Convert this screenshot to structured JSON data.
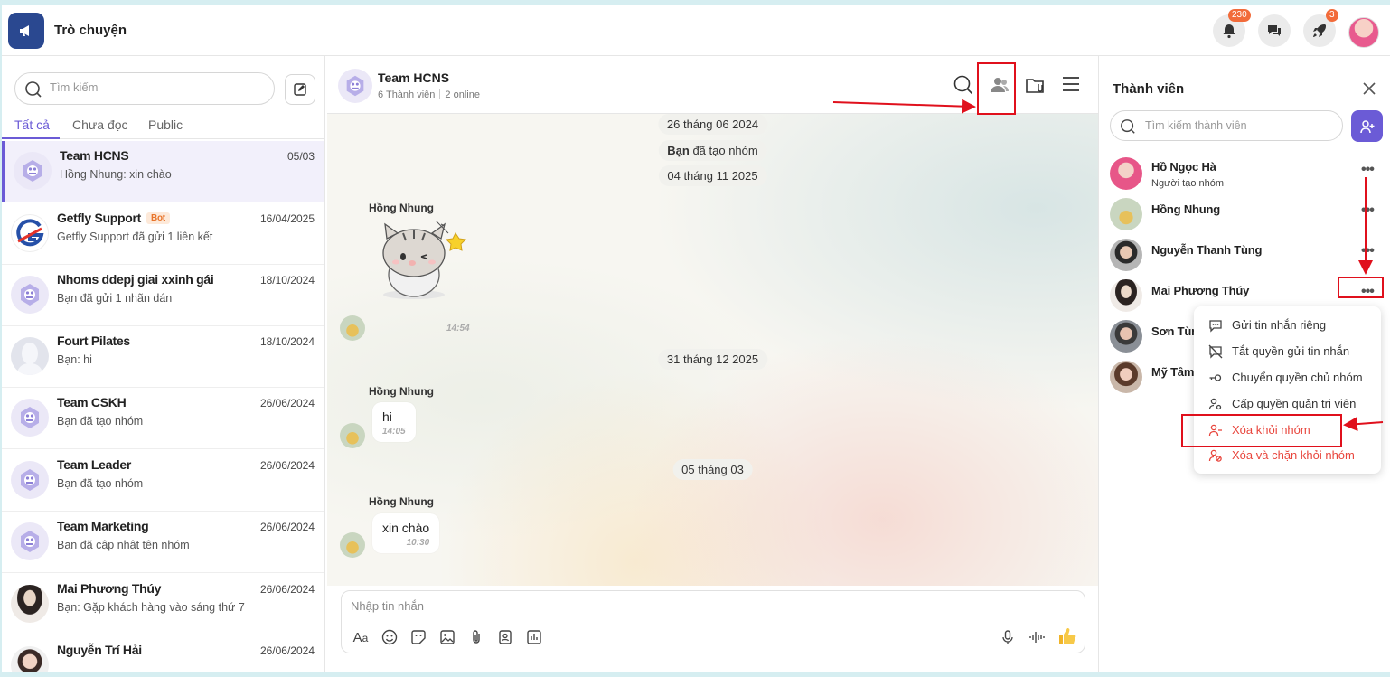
{
  "header": {
    "title": "Trò chuyện",
    "notif_count": "230",
    "rocket_count": "3"
  },
  "sidebar": {
    "search_placeholder": "Tìm kiếm",
    "tabs": [
      "Tất cả",
      "Chưa đọc",
      "Public"
    ],
    "conversations": [
      {
        "name": "Team HCNS",
        "preview": "Hồng Nhung: xin chào",
        "date": "05/03"
      },
      {
        "name": "Getfly Support",
        "badge": "Bot",
        "preview": "Getfly Support đã gửi 1 liên kết",
        "date": "16/04/2025"
      },
      {
        "name": "Nhoms ddepj giai xxinh gái",
        "preview": "Bạn đã gửi 1 nhãn dán",
        "date": "18/10/2024"
      },
      {
        "name": "Fourt Pilates",
        "preview": "Bạn: hi",
        "date": "18/10/2024"
      },
      {
        "name": "Team CSKH",
        "preview": "Bạn đã tạo nhóm",
        "date": "26/06/2024"
      },
      {
        "name": "Team Leader",
        "preview": "Bạn đã tạo nhóm",
        "date": "26/06/2024"
      },
      {
        "name": "Team Marketing",
        "preview": "Bạn đã cập nhật tên nhóm",
        "date": "26/06/2024"
      },
      {
        "name": "Mai Phương Thúy",
        "preview": "Bạn: Gặp khách hàng vào sáng thứ 7",
        "date": "26/06/2024"
      },
      {
        "name": "Nguyễn Trí Hải",
        "preview": "",
        "date": "26/06/2024"
      }
    ]
  },
  "chat": {
    "title": "Team HCNS",
    "members_count": "6 Thành viên",
    "online": "2 online",
    "date1": "26 tháng 06 2024",
    "created_you": "Bạn",
    "created_rest": " đã tạo nhóm",
    "date2": "04 tháng 11 2025",
    "sender": "Hồng Nhung",
    "sticker_time": "14:54",
    "date3": "31 tháng 12 2025",
    "msg1_text": "hi",
    "msg1_time": "14:05",
    "date4": "05 tháng 03",
    "msg2_text": "xin chào",
    "msg2_time": "10:30",
    "composer_placeholder": "Nhập tin nhắn"
  },
  "members_panel": {
    "title": "Thành viên",
    "search_placeholder": "Tìm kiếm thành viên",
    "members": [
      {
        "name": "Hồ Ngọc Hà",
        "role": "Người tạo nhóm"
      },
      {
        "name": "Hồng Nhung"
      },
      {
        "name": "Nguyễn Thanh Tùng"
      },
      {
        "name": "Mai Phương Thúy"
      },
      {
        "name": "Sơn Tùng"
      },
      {
        "name": "Mỹ Tâm"
      }
    ]
  },
  "context_menu": {
    "items": [
      "Gửi tin nhắn riêng",
      "Tắt quyền gửi tin nhắn",
      "Chuyển quyền chủ nhóm",
      "Cấp quyền quản trị viên",
      "Xóa khỏi nhóm",
      "Xóa và chặn khỏi nhóm"
    ]
  }
}
